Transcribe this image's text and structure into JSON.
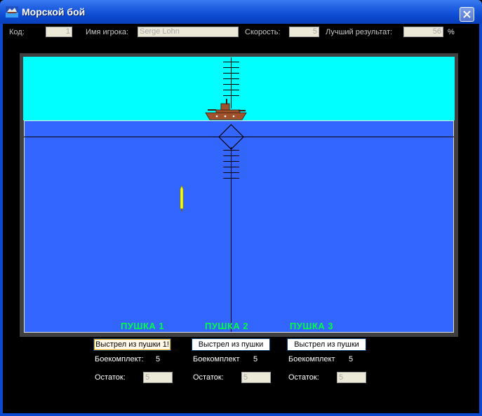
{
  "window": {
    "title": "Морской бой",
    "icon": "battleship-app-icon",
    "close_icon": "close-icon"
  },
  "infobar": {
    "code_label": "Код:",
    "code_value": "1",
    "player_label": "Имя игрока:",
    "player_value": "Serge Lohn",
    "speed_label": "Скорость:",
    "speed_value": "5",
    "best_label": "Лучший результат:",
    "best_value": "56",
    "best_unit": "%"
  },
  "game": {
    "colors": {
      "sky": "#00ffff",
      "sea": "#3366ff",
      "frame": "#404040",
      "gun_label": "#00ff40",
      "torpedo": "#ffff00",
      "ship_hull": "#a0522d"
    },
    "guns": [
      {
        "label": "ПУШКА 1",
        "fire_label": "Выстрел из пушки 1!",
        "ammo_label": "Боекомплект:",
        "ammo_value": "5",
        "rem_label": "Остаток:",
        "rem_value": "5"
      },
      {
        "label": "ПУШКА 2",
        "fire_label": "Выстрел из пушки",
        "ammo_label": "Боекомплект",
        "ammo_value": "5",
        "rem_label": "Остаток:",
        "rem_value": "5"
      },
      {
        "label": "ПУШКА 3",
        "fire_label": "Выстрел из пушки",
        "ammo_label": "Боекомплект",
        "ammo_value": "5",
        "rem_label": "Остаток:",
        "rem_value": "5"
      }
    ]
  }
}
